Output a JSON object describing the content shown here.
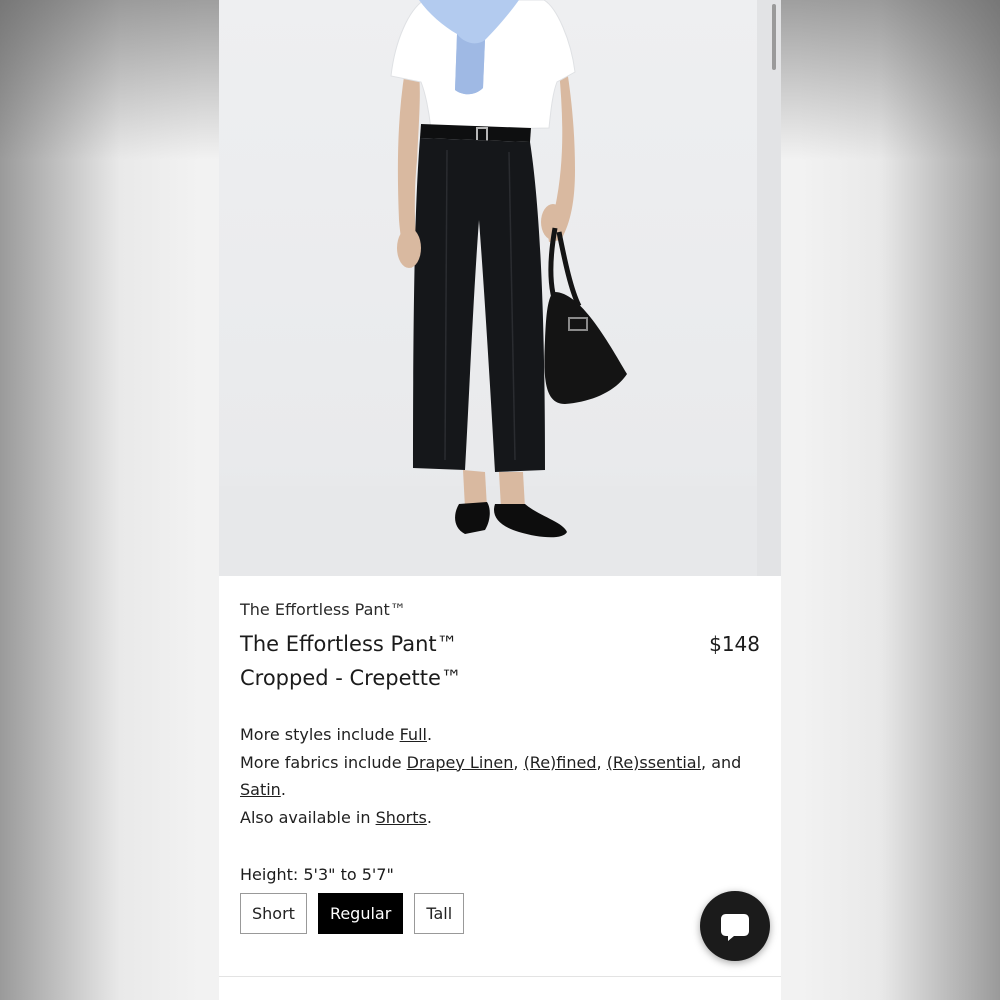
{
  "product": {
    "brand": "The Effortless Pant™",
    "title_line1": "The Effortless Pant™",
    "title_line2": "Cropped - Crepette™",
    "price": "$148"
  },
  "description": {
    "styles_prefix": "More styles include ",
    "styles_links": [
      "Full"
    ],
    "fabrics_prefix": "More fabrics include ",
    "fabrics_links": [
      "Drapey Linen",
      "(Re)fined",
      "(Re)ssential",
      "Satin"
    ],
    "also_prefix": "Also available in ",
    "also_links": [
      "Shorts"
    ]
  },
  "height": {
    "label": "Height: 5'3\" to 5'7\"",
    "options": [
      "Short",
      "Regular",
      "Tall"
    ],
    "selected": "Regular"
  },
  "icons": {
    "chat": "chat-bubble-icon"
  },
  "colors": {
    "selected_bg": "#000000",
    "pants": "#141618",
    "shirt": "#ffffff",
    "sweater": "#a9c3ea"
  }
}
